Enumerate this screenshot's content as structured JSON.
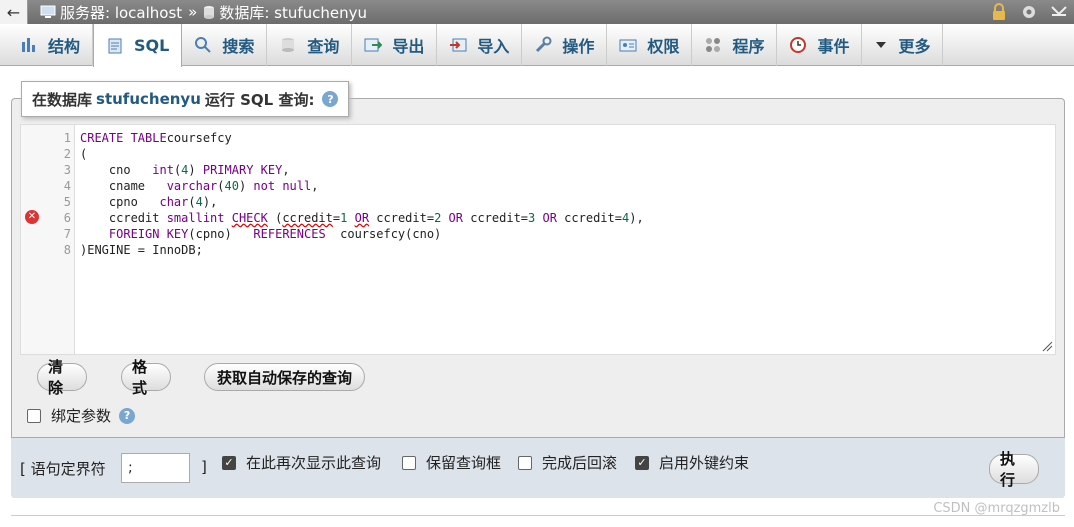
{
  "topbar": {
    "back": "←",
    "server_label": "服务器: localhost",
    "separator": "»",
    "database_label": "数据库: stufuchenyu"
  },
  "tabs": [
    {
      "label": "结构",
      "icon": "structure-icon"
    },
    {
      "label": "SQL",
      "icon": "sql-icon"
    },
    {
      "label": "搜索",
      "icon": "search-icon"
    },
    {
      "label": "查询",
      "icon": "query-icon"
    },
    {
      "label": "导出",
      "icon": "export-icon"
    },
    {
      "label": "导入",
      "icon": "import-icon"
    },
    {
      "label": "操作",
      "icon": "wrench-icon"
    },
    {
      "label": "权限",
      "icon": "privileges-icon"
    },
    {
      "label": "程序",
      "icon": "routines-icon"
    },
    {
      "label": "事件",
      "icon": "events-icon"
    },
    {
      "label": "更多",
      "icon": "caret-down-icon"
    }
  ],
  "query_panel": {
    "title_prefix": "在数据库",
    "db_name": "stufuchenyu",
    "title_suffix": "运行 SQL 查询:"
  },
  "editor": {
    "line_numbers": [
      "1",
      "2",
      "3",
      "4",
      "5",
      "6",
      "7",
      "8"
    ],
    "error_line": "6"
  },
  "buttons": {
    "clear": "清除",
    "format": "格式",
    "autosave": "获取自动保存的查询",
    "execute": "执行"
  },
  "bind_params": "绑定参数",
  "footer": {
    "delimiter_label": "[ 语句定界符",
    "delimiter_value": ";",
    "delimiter_close": "]",
    "options": [
      {
        "label": "在此再次显示此查询",
        "checked": true
      },
      {
        "label": "保留查询框",
        "checked": false
      },
      {
        "label": "完成后回滚",
        "checked": false
      },
      {
        "label": "启用外键约束",
        "checked": true
      }
    ]
  },
  "watermark": "CSDN @mrqzgmzlb",
  "colors": {
    "link": "#235a81",
    "keyword": "#770088",
    "number": "#116644",
    "error": "#d33333"
  }
}
